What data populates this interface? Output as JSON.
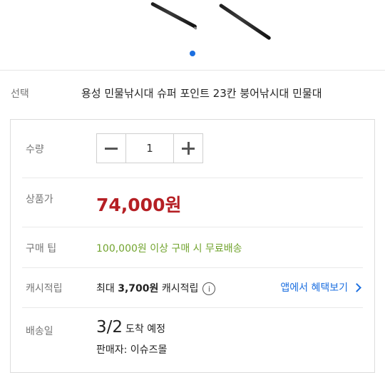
{
  "gallery": {
    "dot_color": "#1c6fe0"
  },
  "option": {
    "label": "선택",
    "value": "용성 민물낚시대 슈퍼 포인트 23칸 붕어낚시대 민물대"
  },
  "quantity": {
    "label": "수량",
    "value": "1",
    "minus_icon": "minus-icon",
    "plus_icon": "plus-icon"
  },
  "price": {
    "label": "상품가",
    "value": "74,000원",
    "color": "#b51f24"
  },
  "tip": {
    "label": "구매 팁",
    "value": "100,000원 이상 구매 시 무료배송",
    "color": "#72a42f"
  },
  "cashback": {
    "label": "캐시적립",
    "prefix": "최대",
    "amount": "3,700원",
    "suffix": "캐시적립",
    "info_icon": "info-icon",
    "app_link": "앱에서 혜택보기",
    "link_color": "#1c6fe0"
  },
  "shipping": {
    "label": "배송일",
    "date": "3/2",
    "status": "도착 예정",
    "seller": "판매자: 이슈즈몰"
  }
}
